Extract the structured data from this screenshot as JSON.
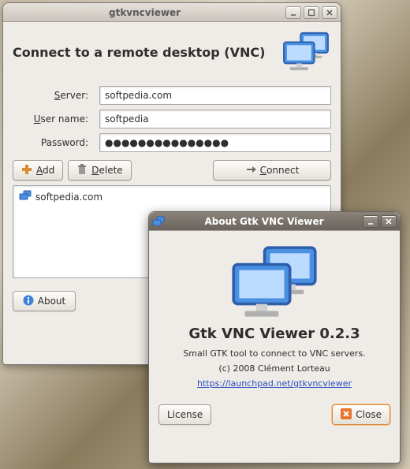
{
  "mainWindow": {
    "title": "gtkvncviewer",
    "heading": "Connect to a remote desktop (VNC)",
    "labels": {
      "server": "Server:",
      "username": "User name:",
      "password": "Password:"
    },
    "fields": {
      "server": "softpedia.com",
      "username": "softpedia",
      "password": "●●●●●●●●●●●●●●●"
    },
    "buttons": {
      "add": "Add",
      "delete": "Delete",
      "connect": "Connect",
      "about": "About"
    },
    "list": {
      "items": [
        {
          "label": "softpedia.com"
        }
      ]
    }
  },
  "aboutDialog": {
    "title": "About Gtk VNC Viewer",
    "appName": "Gtk VNC Viewer 0.2.3",
    "subtitle": "Small GTK tool to connect to VNC servers.",
    "copyright": "(c) 2008 Clément Lorteau",
    "url": "https://launchpad.net/gtkvncviewer",
    "buttons": {
      "license": "License",
      "close": "Close"
    }
  }
}
